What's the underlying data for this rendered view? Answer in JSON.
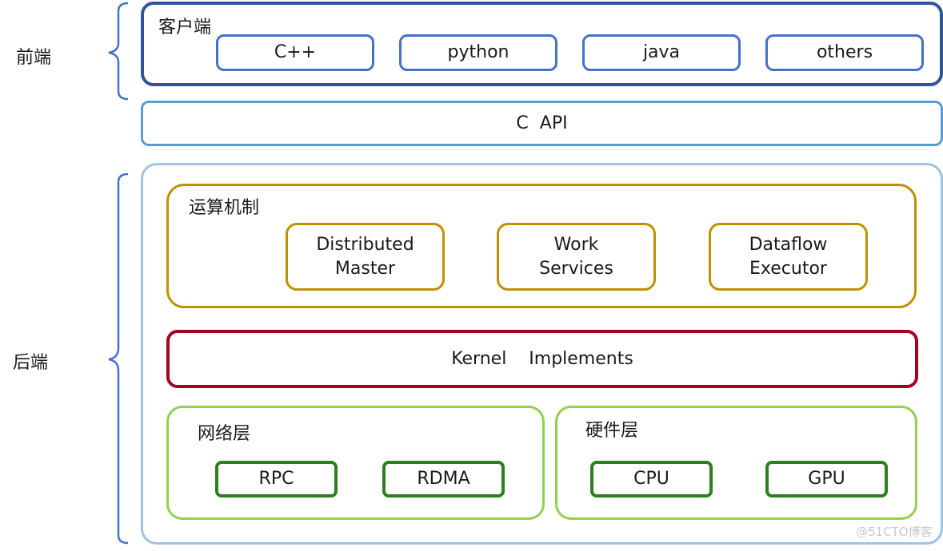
{
  "sections": {
    "frontend_label": "前端",
    "backend_label": "后端"
  },
  "client": {
    "title": "客户端",
    "items": [
      "C++",
      "python",
      "java",
      "others"
    ],
    "border_color": "#2f5597",
    "item_border_color": "#4472c4"
  },
  "c_api": {
    "label": "C  API",
    "border_color": "#5b9bd5"
  },
  "backend": {
    "border_color": "#9dc3e6"
  },
  "compute": {
    "title": "运算机制",
    "items": [
      {
        "line1": "Distributed",
        "line2": "Master"
      },
      {
        "line1": "Work",
        "line2": "Services"
      },
      {
        "line1": "Dataflow",
        "line2": "Executor"
      }
    ],
    "border_color": "#bf9000"
  },
  "kernel": {
    "label": "Kernel    Implements",
    "border_color": "#a50021"
  },
  "network": {
    "title": "网络层",
    "items": [
      "RPC",
      "RDMA"
    ]
  },
  "hardware": {
    "title": "硬件层",
    "items": [
      "CPU",
      "GPU"
    ]
  },
  "layer_colors": {
    "outer_green": "#92d050",
    "inner_green": "#2e7d1f",
    "brace_blue": "#4472c4"
  },
  "watermark": "@51CTO博客"
}
